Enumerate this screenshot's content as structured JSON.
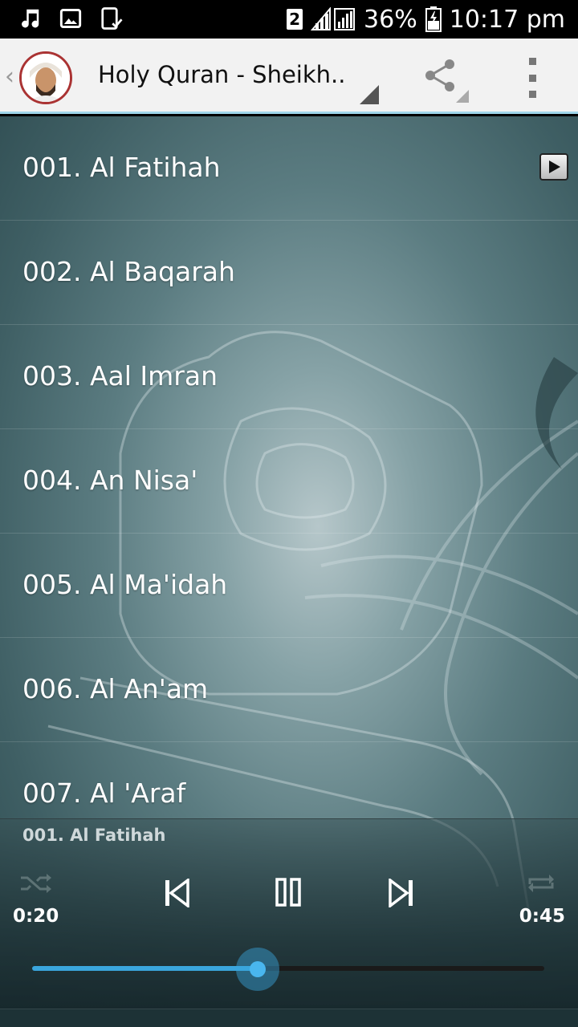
{
  "status_bar": {
    "sim_slot": "2",
    "battery": "36%",
    "time": "10:17 pm",
    "icons": [
      "music-note-icon",
      "image-icon",
      "clipboard-check-icon",
      "signal-icon",
      "battery-icon"
    ]
  },
  "action_bar": {
    "title": "Holy Quran - Sheikh..",
    "back_glyph": "‹",
    "icons": [
      "share-icon",
      "overflow-menu-icon"
    ],
    "accent": "#9fd6ea"
  },
  "surah_list": [
    {
      "label": "001. Al Fatihah",
      "playing": true
    },
    {
      "label": "002. Al Baqarah"
    },
    {
      "label": "003. Aal Imran"
    },
    {
      "label": "004. An Nisa'"
    },
    {
      "label": "005. Al Ma'idah"
    },
    {
      "label": "006. Al An'am"
    },
    {
      "label": "007. Al 'Araf"
    }
  ],
  "player": {
    "now_playing": "001. Al Fatihah",
    "elapsed": "0:20",
    "duration": "0:45",
    "progress": 0.44,
    "accent": "#3aa6dd",
    "icons": [
      "shuffle-icon",
      "previous-icon",
      "pause-icon",
      "next-icon",
      "repeat-icon"
    ]
  }
}
